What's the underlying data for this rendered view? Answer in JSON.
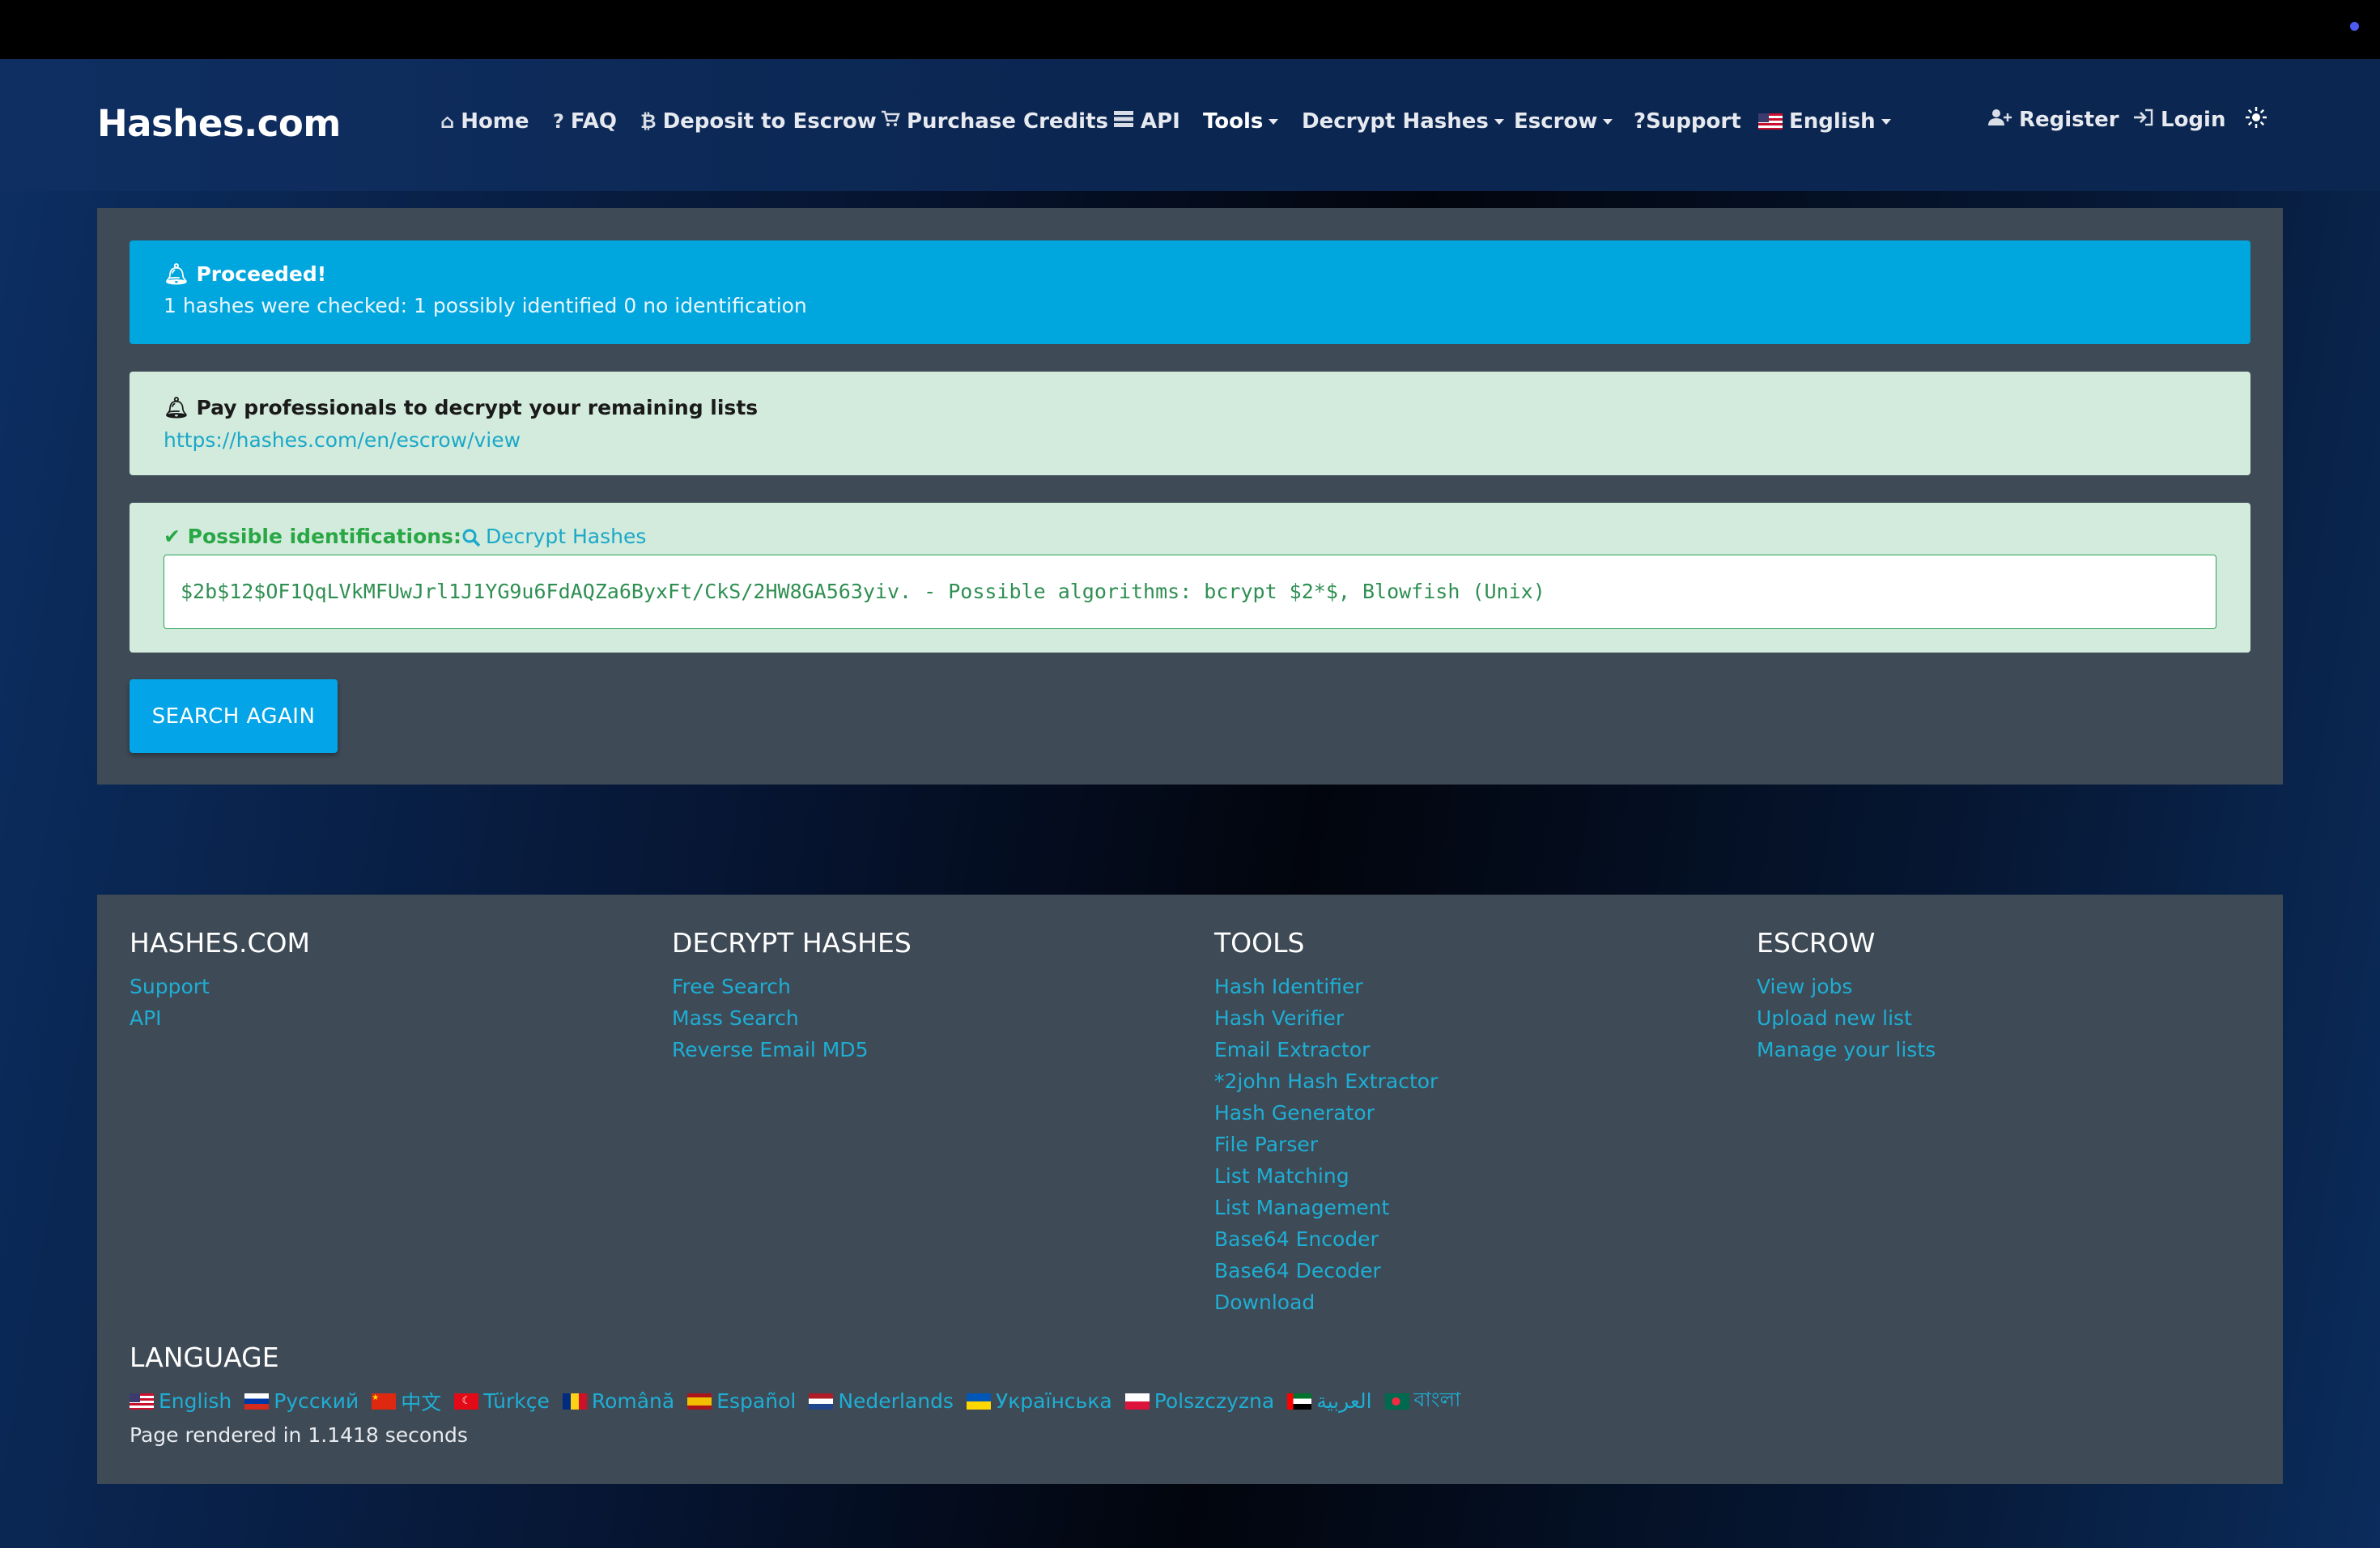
{
  "header": {
    "brand": "Hashes.com",
    "nav": [
      {
        "label": "Home",
        "icon": "home-icon"
      },
      {
        "label": "FAQ",
        "icon": "question-icon"
      },
      {
        "label": "Deposit to Escrow",
        "icon": "bitcoin-icon"
      },
      {
        "label": "Purchase Credits",
        "icon": "cart-icon"
      },
      {
        "label": "API",
        "icon": "server-icon"
      },
      {
        "label": "Tools",
        "icon": ""
      },
      {
        "label": "Decrypt Hashes",
        "icon": ""
      },
      {
        "label": "Escrow",
        "icon": ""
      },
      {
        "label": "?Support",
        "icon": ""
      },
      {
        "label": "English",
        "icon": "us-flag-icon"
      }
    ],
    "register": "Register",
    "login": "Login"
  },
  "alerts": {
    "info": {
      "title": "Proceeded!",
      "text": "1 hashes were checked: 1 possibly identified 0 no identification"
    },
    "promo": {
      "title": "Pay professionals to decrypt your remaining lists",
      "link": "https://hashes.com/en/escrow/view"
    },
    "identification": {
      "title": "Possible identifications:",
      "link": "Decrypt Hashes",
      "result": "$2b$12$OF1QqLVkMFUwJrl1J1YG9u6FdAQZa6ByxFt/CkS/2HW8GA563yiv. - Possible algorithms: bcrypt $2*$, Blowfish (Unix)"
    }
  },
  "search_again": "SEARCH AGAIN",
  "footer": {
    "columns": [
      {
        "heading": "HASHES.COM",
        "links": [
          "Support",
          "API"
        ]
      },
      {
        "heading": "DECRYPT HASHES",
        "links": [
          "Free Search",
          "Mass Search",
          "Reverse Email MD5"
        ]
      },
      {
        "heading": "TOOLS",
        "links": [
          "Hash Identifier",
          "Hash Verifier",
          "Email Extractor",
          "*2john Hash Extractor",
          "Hash Generator",
          "File Parser",
          "List Matching",
          "List Management",
          "Base64 Encoder",
          "Base64 Decoder",
          "Download"
        ]
      },
      {
        "heading": "ESCROW",
        "links": [
          "View jobs",
          "Upload new list",
          "Manage your lists"
        ]
      }
    ],
    "language_heading": "LANGUAGE",
    "languages": [
      "English",
      "Русский",
      "中文",
      "Türkçe",
      "Română",
      "Español",
      "Nederlands",
      "Українська",
      "Polszczyzna",
      "العربية",
      "বাংলা"
    ],
    "rendered": "Page rendered in 1.1418 seconds"
  }
}
